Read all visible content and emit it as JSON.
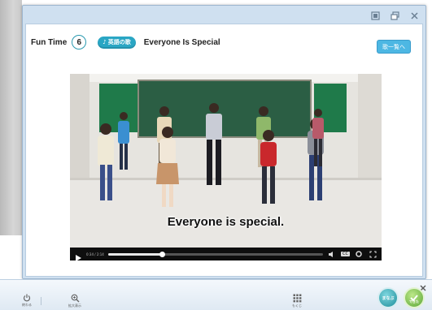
{
  "header": {
    "fun_label": "Fun Time",
    "lesson_number": "6",
    "song_badge": "英語の歌",
    "song_title": "Everyone Is Special",
    "list_button": "歌一覧へ"
  },
  "video": {
    "caption": "Everyone is special.",
    "time": "0:34 / 2:14",
    "progress": 0.25
  },
  "taskbar": {
    "power_label": "終わる",
    "zoom_label": "拡大表示",
    "grid_label": "もくじ",
    "round_left_label": "まなぶ",
    "round_right_label": "できた"
  },
  "colors": {
    "accent": "#2aa6c4",
    "button": "#4db7e3",
    "frame": "#cfe0f0"
  },
  "icons": [
    "restore-icon",
    "minimize-icon",
    "close-icon",
    "play-icon",
    "volume-icon",
    "settings-icon",
    "fullscreen-icon",
    "power-icon",
    "zoom-icon",
    "grid-icon"
  ]
}
